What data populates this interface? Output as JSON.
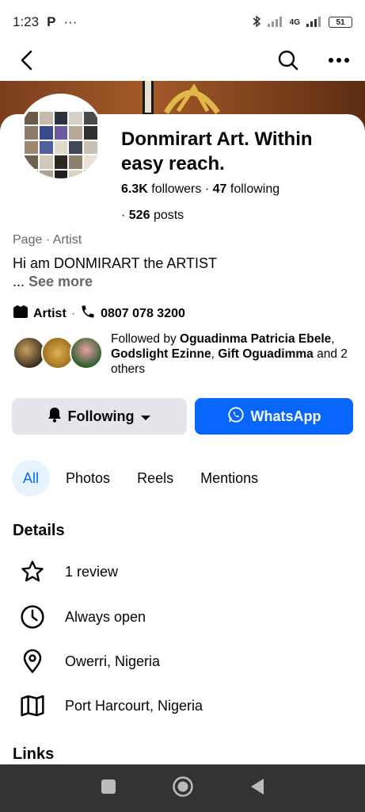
{
  "status_bar": {
    "time": "1:23",
    "app_indicator": "P",
    "more": "···",
    "network": "4G",
    "battery": "51"
  },
  "nav": {
    "back_icon": "chevron-left-icon",
    "search_icon": "search-icon",
    "more_icon": "more-horizontal-icon"
  },
  "profile": {
    "name": "Donmirart Art. Within easy reach.",
    "followers_count": "6.3K",
    "followers_label": "followers",
    "following_count": "47",
    "following_label": "following",
    "posts_count": "526",
    "posts_label": "posts",
    "category": "Page · Artist",
    "bio": "Hi am DONMIRART the ARTIST",
    "see_more": "See more",
    "type": "Artist",
    "phone": "0807 078 3200"
  },
  "followed_by": {
    "prefix": "Followed by ",
    "name1": "Oguadinma Patricia Ebele",
    "sep1": ", ",
    "name2": "Godslight Ezinne",
    "sep2": ", ",
    "name3": "Gift Oguadimma",
    "suffix": " and 2 others"
  },
  "actions": {
    "following_label": "Following",
    "whatsapp_label": "WhatsApp"
  },
  "tabs": [
    {
      "label": "All"
    },
    {
      "label": "Photos"
    },
    {
      "label": "Reels"
    },
    {
      "label": "Mentions"
    }
  ],
  "details": {
    "title": "Details",
    "items": [
      {
        "icon": "star-icon",
        "label": "1 review"
      },
      {
        "icon": "clock-icon",
        "label": "Always open"
      },
      {
        "icon": "location-pin-icon",
        "label": "Owerri, Nigeria"
      },
      {
        "icon": "map-icon",
        "label": "Port Harcourt, Nigeria"
      }
    ]
  },
  "links_title": "Links",
  "colors": {
    "accent": "#0866ff",
    "secondary_button": "#e4e6eb",
    "active_tab_bg": "#e7f3ff",
    "muted_text": "#65676b"
  }
}
